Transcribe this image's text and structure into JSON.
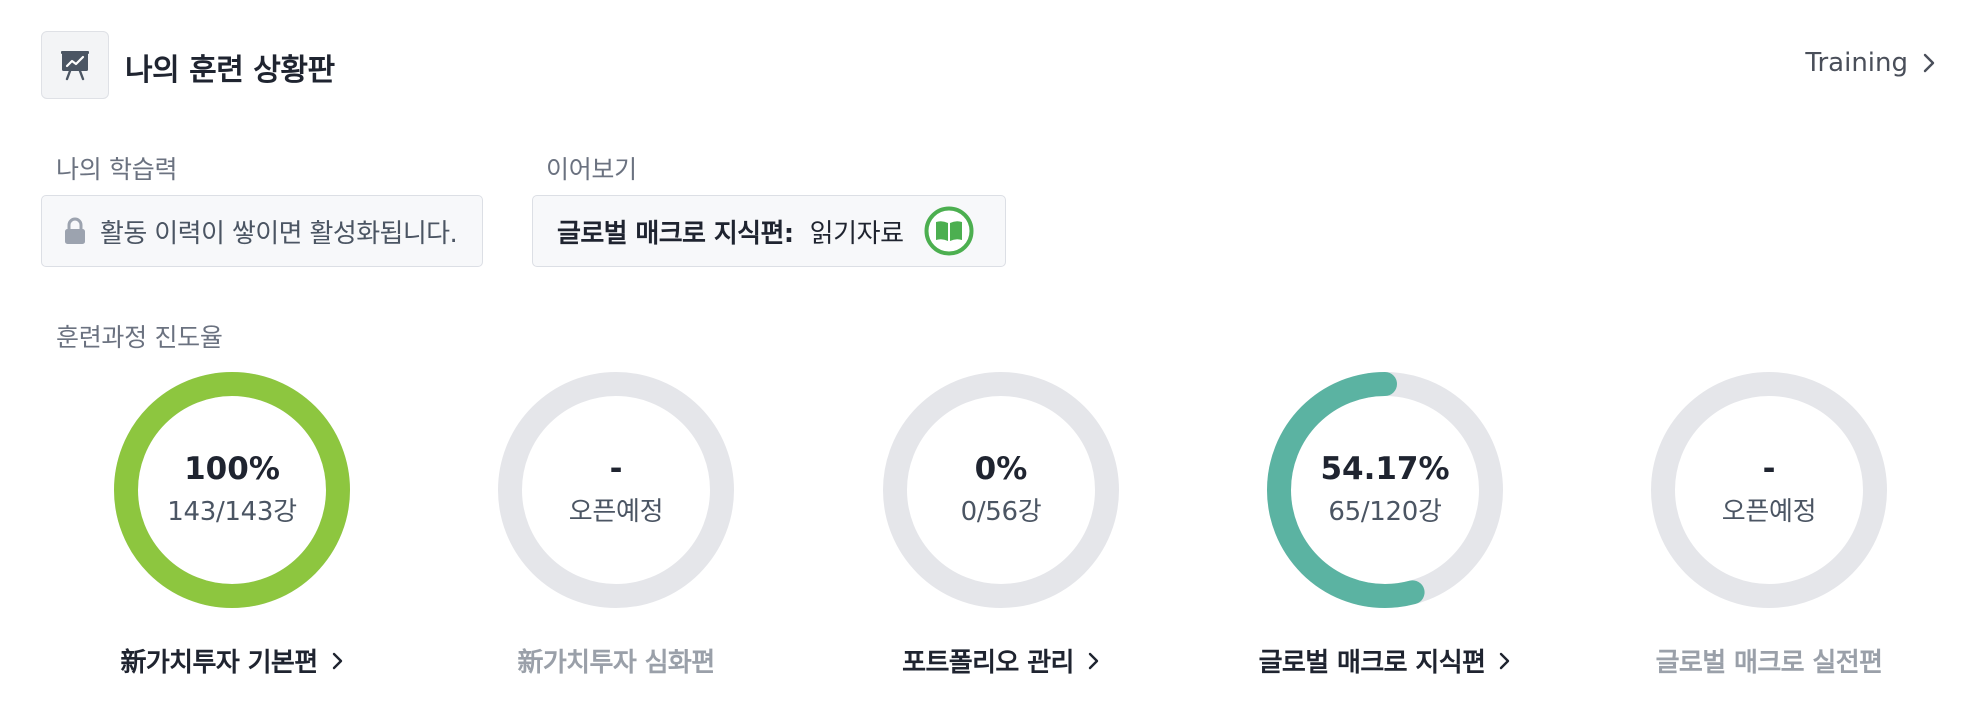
{
  "header": {
    "title": "나의 훈련 상황판",
    "icon": "presentation-chart-icon",
    "link_label": "Training"
  },
  "learning": {
    "label": "나의 학습력",
    "locked_message": "활동 이력이 쌓이면 활성화됩니다."
  },
  "continue": {
    "label": "이어보기",
    "course": "글로벌 매크로 지식편:",
    "type": "읽기자료",
    "icon_color": "#4caf50"
  },
  "progress": {
    "label": "훈련과정 진도율",
    "courses": [
      {
        "title": "新가치투자 기본편",
        "percent_text": "100%",
        "sub": "143/143강",
        "progress": 1.0,
        "color": "#8dc63f",
        "active": true
      },
      {
        "title": "新가치투자 심화편",
        "percent_text": "-",
        "sub": "오픈예정",
        "progress": 0,
        "color": "#e5e6ea",
        "active": false
      },
      {
        "title": "포트폴리오 관리",
        "percent_text": "0%",
        "sub": "0/56강",
        "progress": 0,
        "color": "#e5e6ea",
        "active": true
      },
      {
        "title": "글로벌 매크로 지식편",
        "percent_text": "54.17%",
        "sub": "65/120강",
        "progress": 0.5417,
        "color": "#5bb3a2",
        "active": true
      },
      {
        "title": "글로벌 매크로 실전편",
        "percent_text": "-",
        "sub": "오픈예정",
        "progress": 0,
        "color": "#e5e6ea",
        "active": false
      }
    ],
    "track_color": "#e5e6ea"
  }
}
